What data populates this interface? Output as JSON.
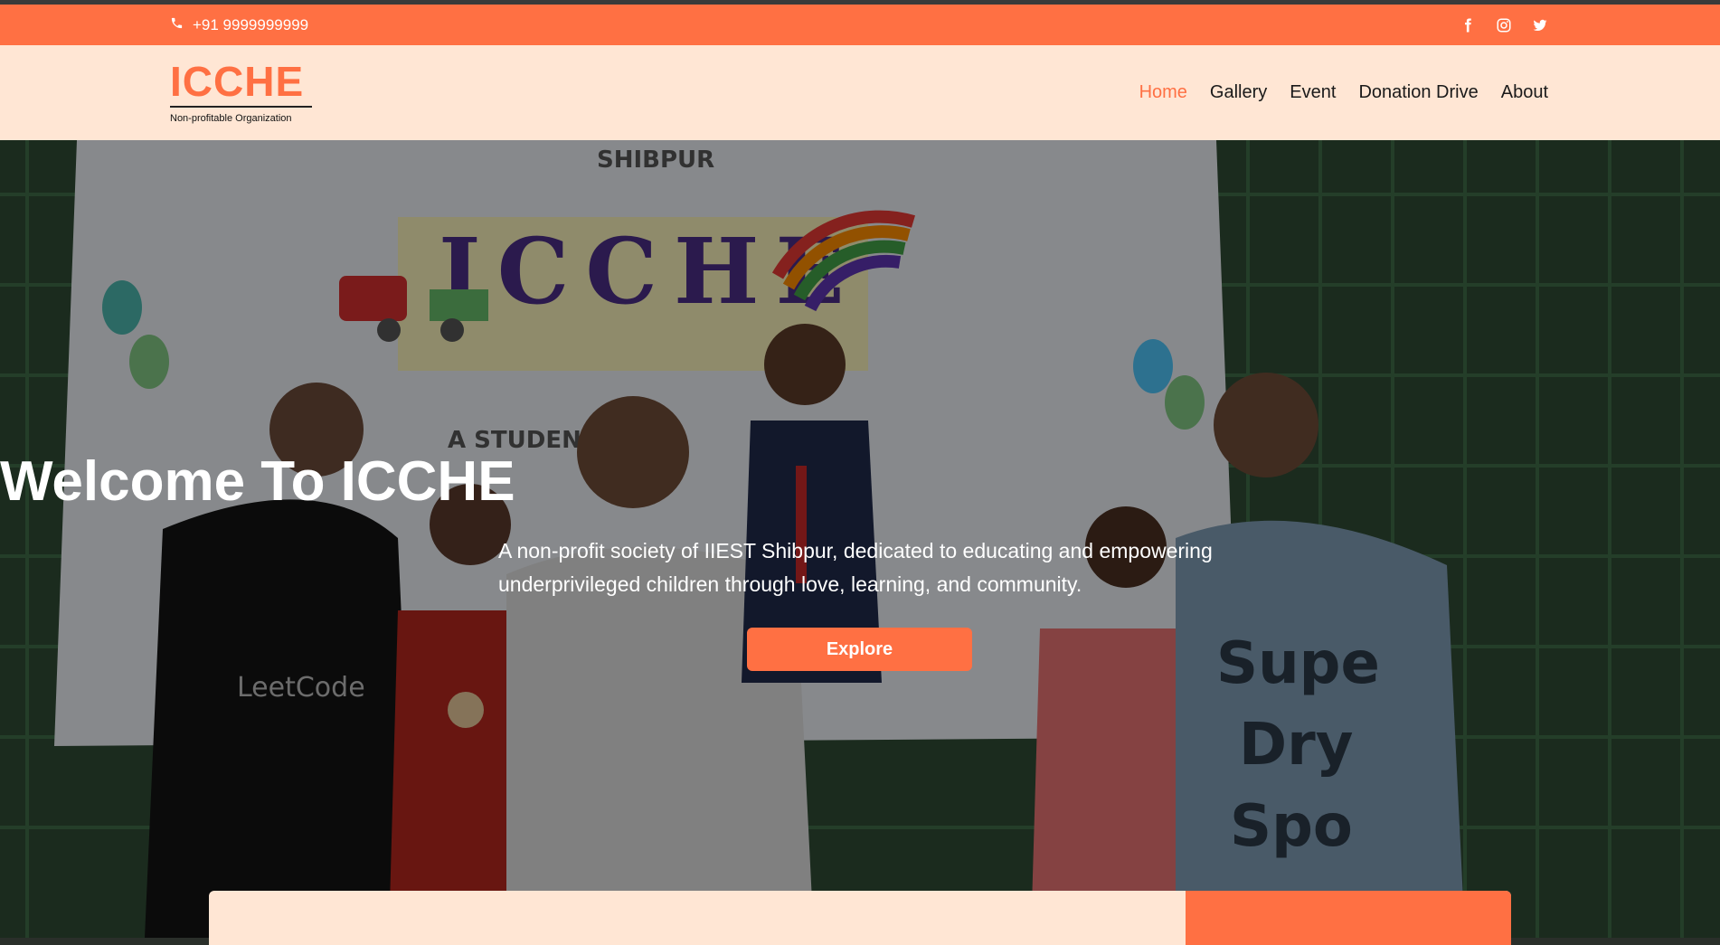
{
  "topbar": {
    "phone_icon": "phone-icon",
    "phone": "+91 9999999999",
    "socials": [
      {
        "name": "facebook-icon"
      },
      {
        "name": "instagram-icon"
      },
      {
        "name": "twitter-icon"
      }
    ]
  },
  "brand": {
    "name": "ICCHE",
    "tagline": "Non-profitable Organization"
  },
  "nav": {
    "items": [
      "Home",
      "Gallery",
      "Event",
      "Donation Drive",
      "About"
    ],
    "active": "Home"
  },
  "hero": {
    "title": "Welcome To ICCHE",
    "subtitle": "A non-profit society of IIEST Shibpur, dedicated to educating and empowering underprivileged children through love, learning, and community.",
    "cta": "Explore",
    "banner_text": {
      "top": "SHIBPUR",
      "main": "ICCHE",
      "partial": "A STUDENTS"
    }
  },
  "colors": {
    "accent": "#ff7043",
    "nav_bg": "#ffe6d4",
    "text_dark": "#1a1a1a"
  }
}
